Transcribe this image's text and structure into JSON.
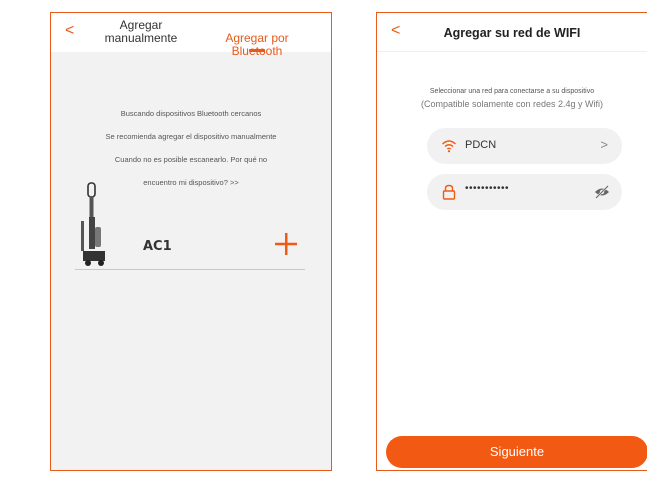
{
  "left_screen": {
    "back": "<",
    "tab_manual": "Agregar\nmanualmente",
    "tab_bluetooth": "Agregar por\nBluetooth",
    "bt_info_lines": [
      "Buscando dispositivos Bluetooth cercanos",
      "Se recomienda agregar el dispositivo manualmente",
      "Cuando no es posible escanearlo. Por qué no",
      "encuentro mi dispositivo? >>"
    ],
    "device_name": "AC1",
    "add_icon": "plus-icon"
  },
  "right_screen": {
    "back": "<",
    "title": "Agregar su red de WIFI",
    "desc_line1": "Seleccionar una red para conectarse a su dispositivo",
    "desc_line2": "(Compatible solamente con redes 2.4g y Wifi)",
    "ssid": "PDCN",
    "ssid_chevron": ">",
    "password": "•••••••••••",
    "next_button": "Siguiente"
  },
  "colors": {
    "accent": "#e85a1a",
    "button": "#f25a14",
    "background_left": "#f2f2f2"
  }
}
